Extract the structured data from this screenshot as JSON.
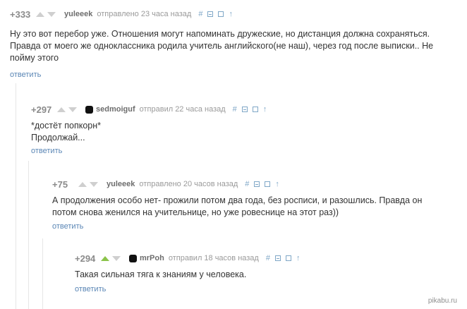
{
  "comments": [
    {
      "rating": "+333",
      "author": "yuleeek",
      "time": "отправлено 23 часа назад",
      "text": "Ну это вот перебор уже. Отношения могут напоминать дружеские, но дистанция должна сохраняться. Правда от моего же одноклассника родила учитель английского(не наш), через год после выписки.. Не пойму этого",
      "reply": "ответить"
    },
    {
      "rating": "+297",
      "author": "sedmoiguf",
      "time": "отправил 22 часа назад",
      "text1": "*достёт попкорн*",
      "text2": "Продолжай...",
      "reply": "ответить"
    },
    {
      "rating": "+75",
      "author": "yuleeek",
      "time": "отправлено 20 часов назад",
      "text": "А продолжения особо нет- прожили потом два года, без росписи, и разошлись. Правда он потом снова женился на учительнице, но уже ровеснице на этот раз))",
      "reply": "ответить"
    },
    {
      "rating": "+294",
      "author": "mrPoh",
      "time": "отправил 18 часов назад",
      "text": "Такая сильная тяга к знаниям у человека.",
      "reply": "ответить"
    }
  ],
  "tools": {
    "hash": "#",
    "up": "↑"
  },
  "colors": {
    "upvote_active": "#8bc34a",
    "link": "#5a86b5"
  },
  "watermark": "pikabu.ru"
}
